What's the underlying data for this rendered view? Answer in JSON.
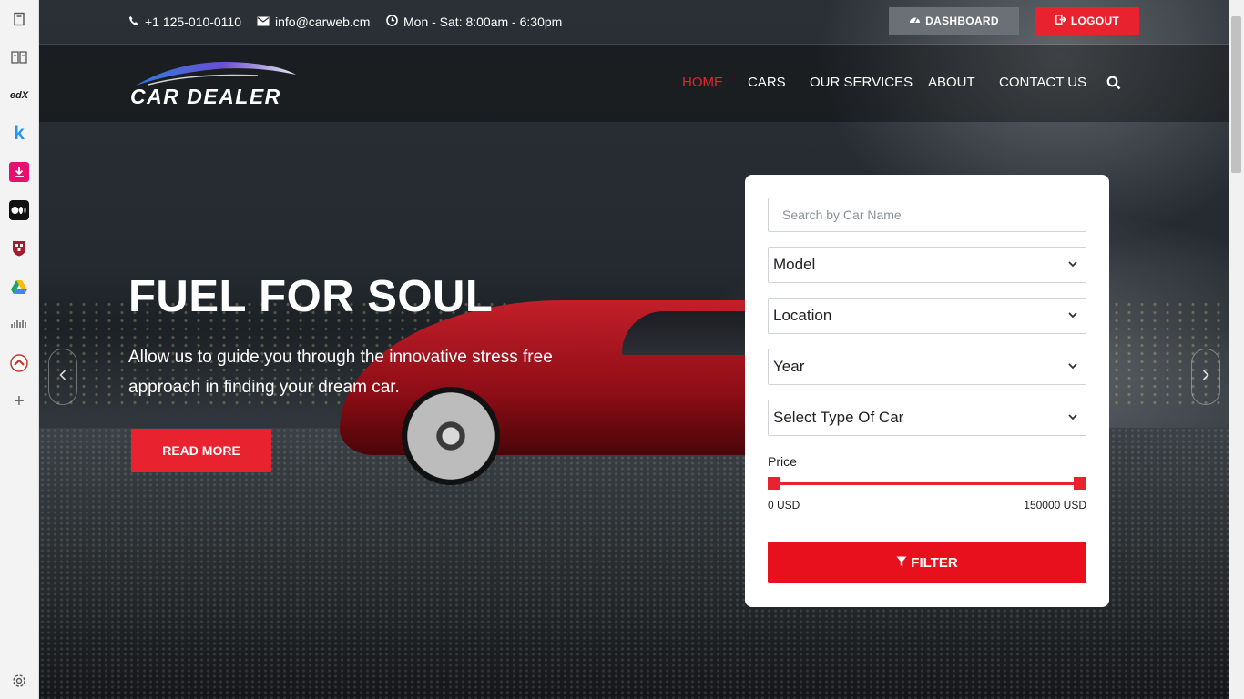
{
  "sidebar": {
    "icons": [
      "bookmark-icon",
      "reader-icon",
      "edx-icon",
      "kobo-icon",
      "download-icon",
      "medium-icon",
      "university-icon",
      "google-drive-icon",
      "cisco-icon",
      "equity-icon",
      "add-icon",
      "settings-icon"
    ],
    "edx_label": "edX",
    "k_label": "k"
  },
  "topbar": {
    "phone": "+1 125-010-0110",
    "email": "info@carweb.cm",
    "hours": "Mon - Sat: 8:00am - 6:30pm",
    "dashboard_label": "DASHBOARD",
    "logout_label": "LOGOUT"
  },
  "header": {
    "logo_text": "CAR DEALER",
    "nav": [
      "HOME",
      "CARS",
      "OUR SERVICES",
      "ABOUT",
      "CONTACT US"
    ],
    "active_nav": "HOME"
  },
  "hero": {
    "headline": "FUEL FOR SOUL",
    "subtext": "Allow us to guide you through the innovative stress free approach in finding your dream car.",
    "cta_label": "READ MORE"
  },
  "search": {
    "name_placeholder": "Search by Car Name",
    "model": "Model",
    "location": "Location",
    "year": "Year",
    "car_type": "Select Type Of Car",
    "price_label": "Price",
    "price_min": "0 USD",
    "price_max": "150000 USD",
    "price_range_fraction": [
      0,
      1
    ],
    "filter_label": "FILTER"
  },
  "colors": {
    "accent": "#e8232f",
    "dashboard_button": "#6b7077",
    "card_bg": "#ffffff"
  }
}
